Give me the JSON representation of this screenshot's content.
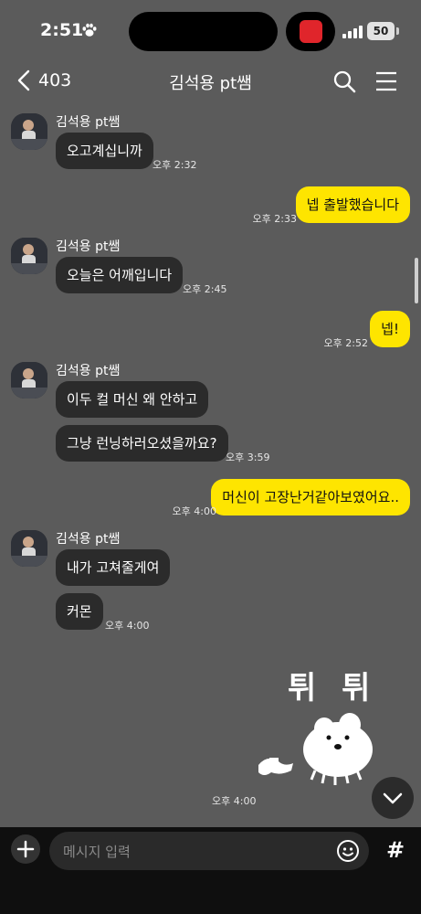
{
  "status_bar": {
    "time": "2:51",
    "battery": "50"
  },
  "header": {
    "back_count": "403",
    "title": "김석용 pt쌤"
  },
  "messages": [
    {
      "sender": "김석용 pt쌤",
      "text": "오고계십니까",
      "time": "오후 2:32"
    },
    {
      "text": "넵 출발했습니다",
      "time": "오후 2:33"
    },
    {
      "sender": "김석용 pt쌤",
      "text": "오늘은 어깨입니다",
      "time": "오후 2:45"
    },
    {
      "text": "넵!",
      "time": "오후 2:52"
    },
    {
      "sender": "김석용 pt쌤",
      "text": "이두 컬 머신 왜 안하고"
    },
    {
      "text": "그냥 런닝하러오셨을까요?",
      "time": "오후 3:59"
    },
    {
      "text": "머신이 고장난거같아보였어요..",
      "time": "오후 4:00"
    },
    {
      "sender": "김석용 pt쌤",
      "text": "내가 고쳐줄게여"
    },
    {
      "text": "커몬",
      "time": "오후 4:00"
    },
    {
      "sticker_text": "튀 튀",
      "time": "오후 4:00"
    }
  ],
  "input": {
    "placeholder": "메시지 입력"
  },
  "icons": {
    "back": "chevron-left-icon",
    "search": "search-icon",
    "menu": "hamburger-menu-icon",
    "plus": "plus-icon",
    "emoji": "emoji-icon",
    "hash": "hash-icon",
    "down": "chevron-down-icon"
  },
  "hash_glyph": "#",
  "colors": {
    "background": "#5b5b5b",
    "incoming_bubble": "#2b2b2b",
    "outgoing_bubble": "#fee500",
    "bottom_bar": "#0f0f0f"
  }
}
